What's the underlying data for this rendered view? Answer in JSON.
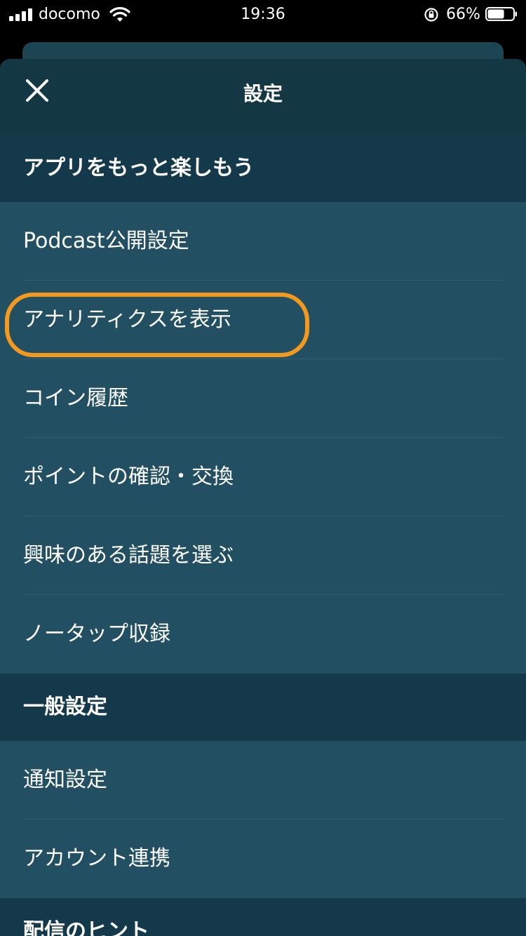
{
  "status_bar": {
    "carrier": "docomo",
    "time": "19:36",
    "battery_percent": "66%",
    "battery_level": 0.66,
    "signal_bars": 4
  },
  "header": {
    "title": "設定",
    "close_icon": "close-icon"
  },
  "sections": [
    {
      "title": "アプリをもっと楽しもう",
      "items": [
        {
          "label": "Podcast公開設定"
        },
        {
          "label": "アナリティクスを表示",
          "highlighted": true
        },
        {
          "label": "コイン履歴"
        },
        {
          "label": "ポイントの確認・交換"
        },
        {
          "label": "興味のある話題を選ぶ"
        },
        {
          "label": "ノータップ収録"
        }
      ]
    },
    {
      "title": "一般設定",
      "items": [
        {
          "label": "通知設定"
        },
        {
          "label": "アカウント連携"
        }
      ]
    },
    {
      "title": "配信のヒント",
      "items": []
    }
  ],
  "colors": {
    "sheet_background": "#143845",
    "item_background": "#234f62",
    "highlight": "#f39a1e"
  }
}
